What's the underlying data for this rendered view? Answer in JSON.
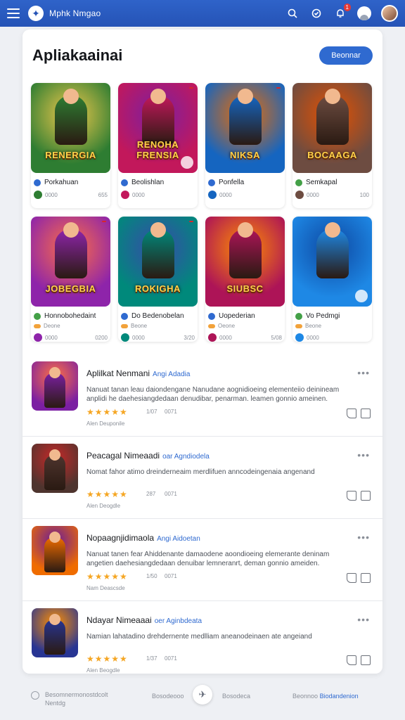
{
  "header": {
    "brand": "Mphk Nmgao",
    "notification_count": "1"
  },
  "main": {
    "title": "Apliakaainai",
    "primary_button": "Beonnar"
  },
  "apps": [
    {
      "art_title": "RENERGIA",
      "name": "Porkahuan",
      "meta_left": "0000",
      "meta_right": "655",
      "colors": [
        "#2e7d32",
        "#f2c94c"
      ],
      "dot": "#2f6ad0"
    },
    {
      "art_title": "RENOHA FRENSIA",
      "name": "Beolishlan",
      "meta_left": "0000",
      "meta_right": "",
      "colors": [
        "#c2185b",
        "#7b1fa2"
      ],
      "dot": "#2f6ad0"
    },
    {
      "art_title": "NIKSA",
      "name": "Ponfella",
      "meta_left": "0000",
      "meta_right": "",
      "colors": [
        "#1565c0",
        "#ef6c00"
      ],
      "dot": "#2f6ad0"
    },
    {
      "art_title": "BOCAAGA",
      "name": "Semkapal",
      "meta_left": "0000",
      "meta_right": "100",
      "colors": [
        "#6d4c41",
        "#e65100"
      ],
      "dot": "#43a047"
    },
    {
      "art_title": "JOBEGBIA",
      "name": "Honnobohedaint",
      "sub": "Deone",
      "meta_left": "0000",
      "meta_right": "0200",
      "colors": [
        "#8e24aa",
        "#ff7043"
      ],
      "dot": "#43a047"
    },
    {
      "art_title": "ROKIGHA",
      "name": "Do Bedenobelan",
      "sub": "Beone",
      "meta_left": "0000",
      "meta_right": "3/20",
      "colors": [
        "#00897b",
        "#3949ab"
      ],
      "dot": "#2f6ad0"
    },
    {
      "art_title": "SIUBSC",
      "name": "Uopederian",
      "sub": "Oeone",
      "meta_left": "0000",
      "meta_right": "5/08",
      "colors": [
        "#ad1457",
        "#ff8f00"
      ],
      "dot": "#2f6ad0"
    },
    {
      "art_title": "",
      "name": "Vo Pedmgi",
      "sub": "Beone",
      "meta_left": "0000",
      "meta_right": "",
      "colors": [
        "#1e88e5",
        "#0d47a1"
      ],
      "dot": "#43a047"
    }
  ],
  "list_items": [
    {
      "title": "Aplilkat Nenmani",
      "tag": "Angi Adadia",
      "description": "Nanuat tanan leau daiondengane Nanudane aognidioeing elementeiio deinineam anplidi he daehesiangdedaan denudibar, penarman. leamen gonnio ameinen.",
      "stars": "★★★★★",
      "count": "1/07",
      "downloads": "0071",
      "author": "Alen Deuponile",
      "colors": [
        "#7b1fa2",
        "#ff7043"
      ]
    },
    {
      "title": "Peacagal Nimeaadi",
      "tag": "oar Agndiodela",
      "description": "Nomat fahor atimo dreinderneaim merdlifuen anncodeingenaia angenand",
      "stars": "★★★★★",
      "count": "287",
      "downloads": "0071",
      "author": "Alen Deogdle",
      "colors": [
        "#4e342e",
        "#c62828"
      ]
    },
    {
      "title": "Nopaagnjidimaola",
      "tag": "Angi Aidoetan",
      "description": "Nanuat tanen fear Ahiddenante damaodene aoondioeing elemerante deninam angetien daehesiangdedaan denuibar lemneranrt, deman gonnio ameiden.",
      "stars": "★★★★★",
      "count": "1/50",
      "downloads": "0071",
      "author": "Nam Deascsde",
      "colors": [
        "#ef6c00",
        "#6a1b9a"
      ]
    },
    {
      "title": "Ndayar Nimeaaai",
      "tag": "oer Aginbdeata",
      "description": "Namian lahatadino drehdernente medlliam aneanodeinaen ate angeiand",
      "stars": "★★★★★",
      "count": "1/37",
      "downloads": "0071",
      "author": "Alen Beogdle",
      "colors": [
        "#283593",
        "#ff8f00"
      ]
    }
  ],
  "footer": {
    "left_line1": "Besomnermonostdcolt",
    "left_line2": "Nentdg",
    "mid_left": "Bosodeooo",
    "mid_right": "Bosodeca",
    "right_label": "Beonnoo",
    "right_link": "Biodandenion"
  }
}
